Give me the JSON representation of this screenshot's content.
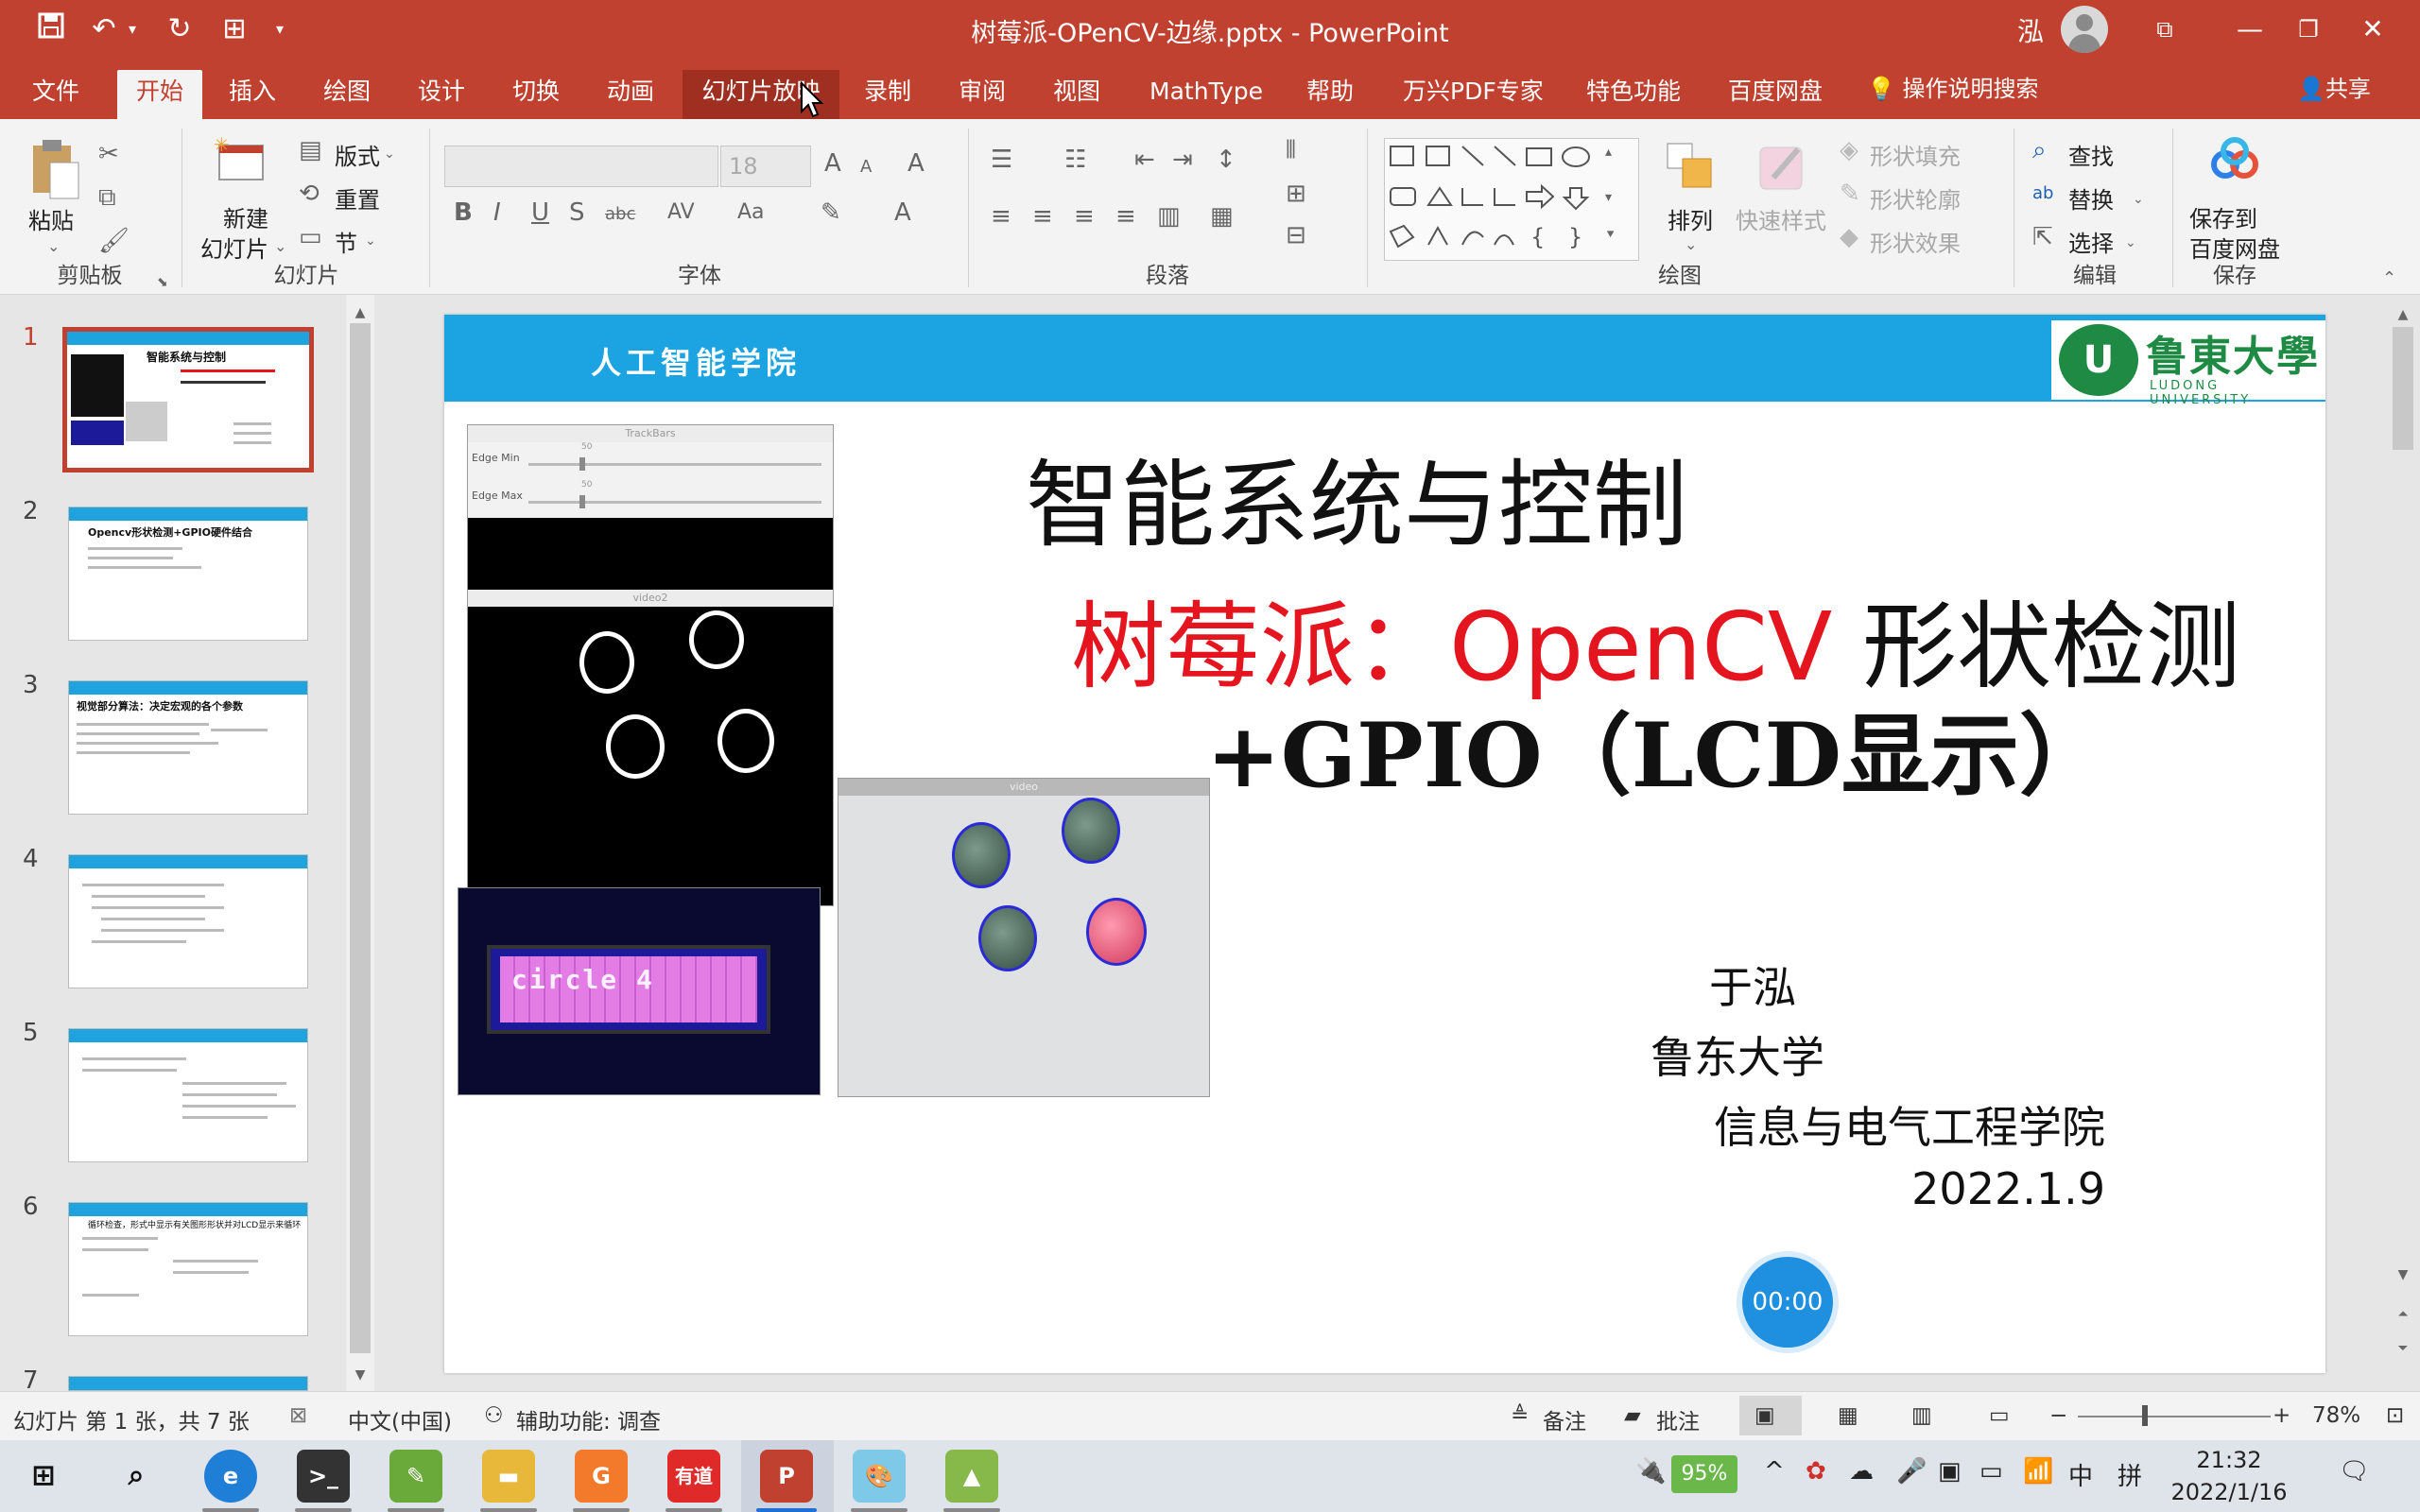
{
  "titlebar": {
    "doc_title": "树莓派-OPenCV-边缘.pptx - PowerPoint",
    "user_name": "泓"
  },
  "tabs": [
    "文件",
    "开始",
    "插入",
    "绘图",
    "设计",
    "切换",
    "动画",
    "幻灯片放映",
    "录制",
    "审阅",
    "视图",
    "MathType",
    "帮助",
    "万兴PDF专家",
    "特色功能",
    "百度网盘"
  ],
  "tell_me": "操作说明搜索",
  "share": "共享",
  "ribbon": {
    "clipboard": {
      "label": "剪贴板",
      "paste": "粘贴"
    },
    "slides": {
      "label": "幻灯片",
      "new_slide_1": "新建",
      "new_slide_2": "幻灯片",
      "layout": "版式",
      "reset": "重置",
      "section": "节"
    },
    "font": {
      "label": "字体",
      "size": "18"
    },
    "paragraph": {
      "label": "段落"
    },
    "drawing": {
      "label": "绘图",
      "arrange": "排列",
      "quick_styles": "快速样式",
      "shape_fill": "形状填充",
      "shape_outline": "形状轮廓",
      "shape_effects": "形状效果"
    },
    "editing": {
      "label": "编辑",
      "find": "查找",
      "replace": "替换",
      "select": "选择"
    },
    "save": {
      "label": "保存",
      "save_to_1": "保存到",
      "save_to_2": "百度网盘"
    }
  },
  "thumbnails": [
    {
      "num": "1",
      "title": "智能系统与控制"
    },
    {
      "num": "2",
      "title": "Opencv形状检测+GPIO硬件结合"
    },
    {
      "num": "3",
      "title": "视觉部分算法：决定宏观的各个参数"
    },
    {
      "num": "4",
      "title": ""
    },
    {
      "num": "5",
      "title": ""
    },
    {
      "num": "6",
      "title": "循环检查，形式中显示有关图形形状并对LCD显示来循环"
    },
    {
      "num": "7",
      "title": ""
    }
  ],
  "slide": {
    "college": "人工智能学院",
    "logo_cn": "鲁東大學",
    "logo_en": "LUDONG UNIVERSITY",
    "title1": "智能系统与控制",
    "title2_red": "树莓派：OpenCV",
    "title2_black": " 形状检测",
    "title3": "+GPIO（LCD显示）",
    "author": "于泓",
    "university": "鲁东大学",
    "school": "信息与电气工程学院",
    "date": "2022.1.9",
    "trackbars_title": "TrackBars",
    "edge_min": "Edge Min",
    "edge_max": "Edge Max",
    "track_value": "50",
    "video2_title": "video2",
    "video_title": "video",
    "lcd_text": "circle 4",
    "timer": "00:00"
  },
  "status": {
    "slide_info": "幻灯片 第 1 张，共 7 张",
    "language": "中文(中国)",
    "accessibility": "辅助功能: 调查",
    "notes": "备注",
    "comments": "批注",
    "zoom": "78%"
  },
  "taskbar": {
    "battery": "95%",
    "ime_1": "中",
    "ime_2": "拼",
    "time": "21:32",
    "date": "2022/1/16"
  },
  "colors": {
    "accent": "#c0412f",
    "slide_band": "#1ca4e2",
    "title_red": "#e5151f"
  }
}
